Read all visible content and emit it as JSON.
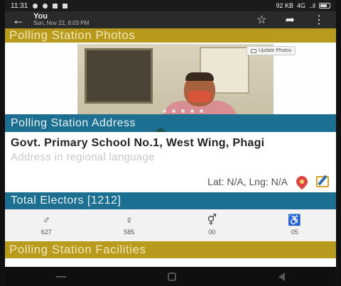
{
  "status_bar": {
    "time": "11:31",
    "speed": "92 KB",
    "network": "4G",
    "signal": "..il",
    "battery_icon": "battery-icon"
  },
  "app_bar": {
    "back_icon": "arrow-left-icon",
    "title": "You",
    "subtitle": "Sun, Nov 22, 8:03 PM",
    "actions": [
      "star-icon",
      "share-icon",
      "more-vert-icon"
    ]
  },
  "sections": {
    "photos_title": "Polling Station Photos",
    "update_photos_label": "Update Photos",
    "address_title": "Polling Station Address",
    "electors_title": "Total Electors [1212]",
    "facilities_title": "Polling Station Facilities"
  },
  "address": {
    "line": "Govt. Primary School No.1, West Wing, Phagi",
    "regional_placeholder": "Address in regional language",
    "latlng": "Lat: N/A, Lng: N/A"
  },
  "electors": [
    {
      "icon": "male-icon",
      "value": "627"
    },
    {
      "icon": "female-icon",
      "value": "585"
    },
    {
      "icon": "third-gender-icon",
      "value": "00"
    },
    {
      "icon": "pwd-wheelchair-icon",
      "value": "05"
    }
  ],
  "colors": {
    "gold_header": "#b89a1d",
    "teal_header": "#1d6f91"
  }
}
